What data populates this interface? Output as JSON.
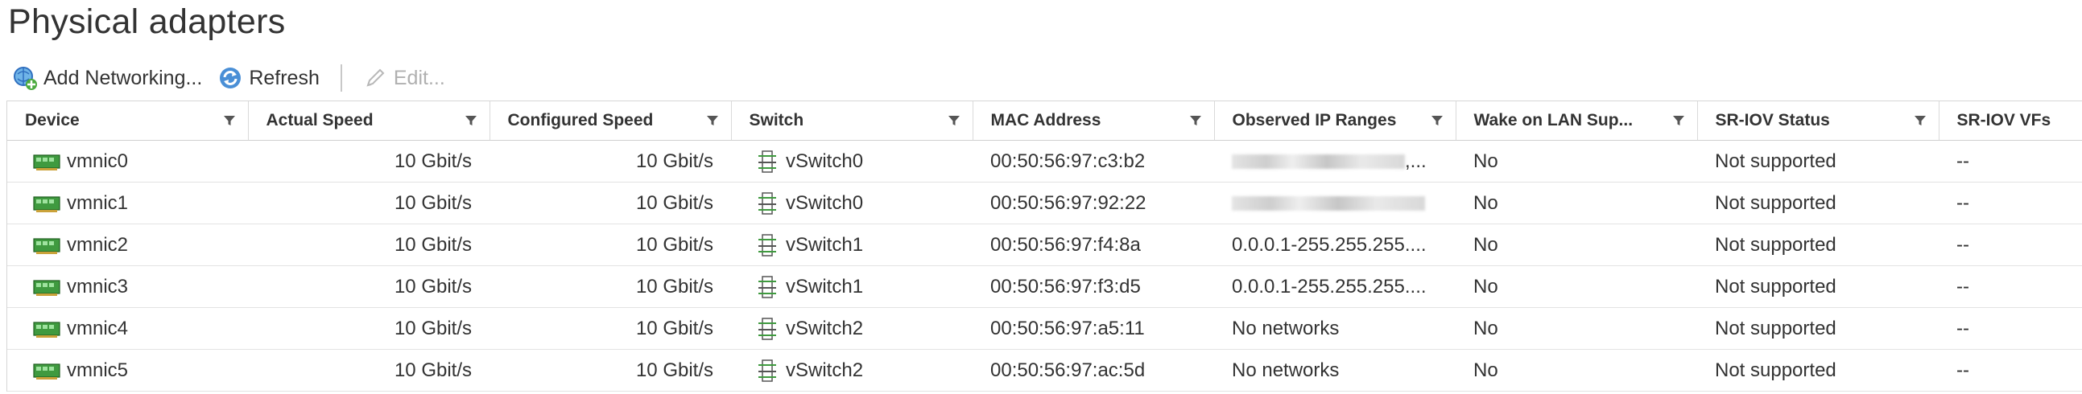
{
  "page": {
    "title": "Physical adapters"
  },
  "toolbar": {
    "add_label": "Add Networking...",
    "refresh_label": "Refresh",
    "edit_label": "Edit..."
  },
  "columns": [
    "Device",
    "Actual Speed",
    "Configured Speed",
    "Switch",
    "MAC Address",
    "Observed IP Ranges",
    "Wake on LAN Sup...",
    "SR-IOV Status",
    "SR-IOV VFs"
  ],
  "rows": [
    {
      "device": "vmnic0",
      "actual": "10 Gbit/s",
      "configured": "10 Gbit/s",
      "switch": "vSwitch0",
      "mac": "00:50:56:97:c3:b2",
      "ip": "",
      "ip_suffix": ",...",
      "wol": "No",
      "sriov": "Not supported",
      "vfs": "--"
    },
    {
      "device": "vmnic1",
      "actual": "10 Gbit/s",
      "configured": "10 Gbit/s",
      "switch": "vSwitch0",
      "mac": "00:50:56:97:92:22",
      "ip": "",
      "ip_suffix": "",
      "wol": "No",
      "sriov": "Not supported",
      "vfs": "--"
    },
    {
      "device": "vmnic2",
      "actual": "10 Gbit/s",
      "configured": "10 Gbit/s",
      "switch": "vSwitch1",
      "mac": "00:50:56:97:f4:8a",
      "ip": "0.0.0.1-255.255.255....",
      "ip_suffix": "",
      "wol": "No",
      "sriov": "Not supported",
      "vfs": "--"
    },
    {
      "device": "vmnic3",
      "actual": "10 Gbit/s",
      "configured": "10 Gbit/s",
      "switch": "vSwitch1",
      "mac": "00:50:56:97:f3:d5",
      "ip": "0.0.0.1-255.255.255....",
      "ip_suffix": "",
      "wol": "No",
      "sriov": "Not supported",
      "vfs": "--"
    },
    {
      "device": "vmnic4",
      "actual": "10 Gbit/s",
      "configured": "10 Gbit/s",
      "switch": "vSwitch2",
      "mac": "00:50:56:97:a5:11",
      "ip": "No networks",
      "ip_suffix": "",
      "wol": "No",
      "sriov": "Not supported",
      "vfs": "--"
    },
    {
      "device": "vmnic5",
      "actual": "10 Gbit/s",
      "configured": "10 Gbit/s",
      "switch": "vSwitch2",
      "mac": "00:50:56:97:ac:5d",
      "ip": "No networks",
      "ip_suffix": "",
      "wol": "No",
      "sriov": "Not supported",
      "vfs": "--"
    }
  ],
  "icons": {
    "add": "add-networking-icon",
    "refresh": "refresh-icon",
    "edit": "pencil-icon",
    "filter": "filter-funnel-icon",
    "device": "network-card-icon",
    "switch": "virtual-switch-icon"
  },
  "colors": {
    "nic_green": "#3f9a3f",
    "refresh_blue": "#2f6fbf",
    "disabled": "#b0b0b0"
  }
}
